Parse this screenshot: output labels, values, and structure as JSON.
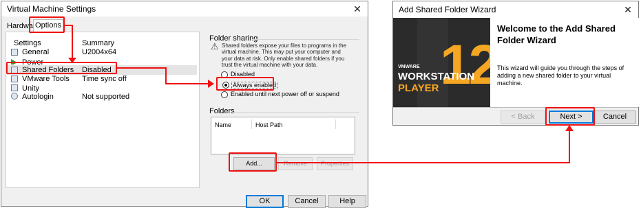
{
  "vm_settings": {
    "title": "Virtual Machine Settings",
    "tabs": [
      "Hardware",
      "Options"
    ],
    "list_headers": {
      "settings": "Settings",
      "summary": "Summary"
    },
    "items": [
      {
        "name": "General",
        "summary": "U2004x64"
      },
      {
        "name": "Power",
        "summary": ""
      },
      {
        "name": "Shared Folders",
        "summary": "Disabled"
      },
      {
        "name": "VMware Tools",
        "summary": "Time sync off"
      },
      {
        "name": "Unity",
        "summary": ""
      },
      {
        "name": "Autologin",
        "summary": "Not supported"
      }
    ],
    "folder_sharing": {
      "title": "Folder sharing",
      "warning": "Shared folders expose your files to programs in the virtual machine. This may put your computer and your data at risk. Only enable shared folders if you trust the virtual machine with your data.",
      "options": [
        "Disabled",
        "Always enabled",
        "Enabled until next power off or suspend"
      ],
      "selected": "Always enabled"
    },
    "folders": {
      "title": "Folders",
      "columns": [
        "Name",
        "Host Path"
      ],
      "buttons": {
        "add": "Add...",
        "remove": "Remove",
        "properties": "Properties"
      }
    },
    "footer": {
      "ok": "OK",
      "cancel": "Cancel",
      "help": "Help"
    }
  },
  "wizard": {
    "title": "Add Shared Folder Wizard",
    "heading": "Welcome to the Add Shared Folder Wizard",
    "body": "This wizard will guide you through the steps of adding a new shared folder to your virtual machine.",
    "banner": {
      "brand": "VMWARE",
      "product_1": "WORKSTATION",
      "product_2": "PLAYER",
      "version": "12"
    },
    "buttons": {
      "back": "< Back",
      "next": "Next >",
      "cancel": "Cancel"
    }
  },
  "colors": {
    "highlight": "#e11111",
    "banner_bg": "#2b2b2b",
    "banner_accent": "#f5a623"
  }
}
